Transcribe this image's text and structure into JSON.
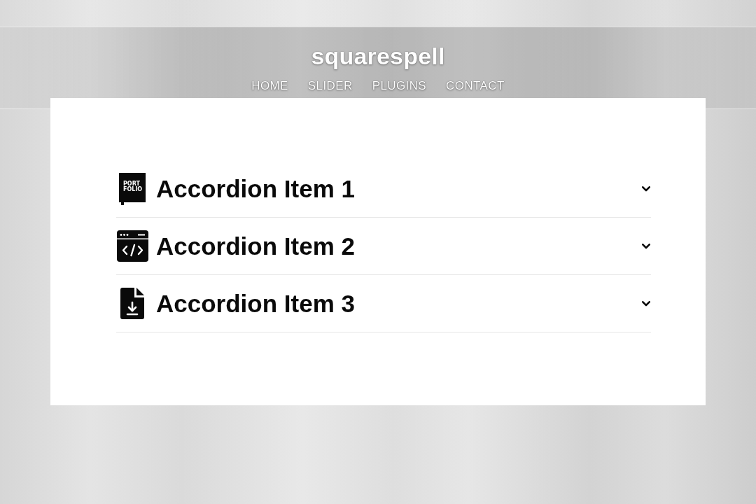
{
  "header": {
    "logo": "squarespell",
    "nav": [
      "HOME",
      "SLIDER",
      "PLUGINS",
      "CONTACT"
    ]
  },
  "accordion": {
    "items": [
      {
        "title": "Accordion Item 1",
        "icon_text": [
          "PORT",
          "FOLIO"
        ],
        "expanded": false
      },
      {
        "title": "Accordion Item 2",
        "expanded": false
      },
      {
        "title": "Accordion Item 3",
        "expanded": false
      }
    ]
  }
}
